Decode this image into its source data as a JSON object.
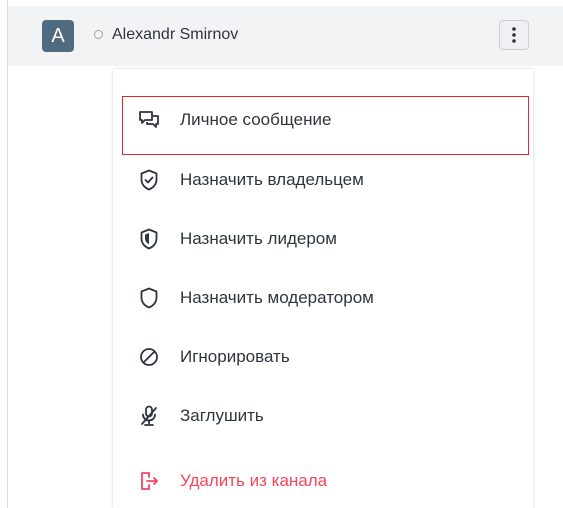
{
  "user": {
    "avatar_letter": "A",
    "name": "Alexandr Smirnov",
    "status": "offline"
  },
  "header": {
    "kebab_icon": "kebab-menu-icon"
  },
  "menu": {
    "items": [
      {
        "label": "Личное сообщение",
        "icon": "direct-message-icon",
        "danger": false
      },
      {
        "label": "Назначить владельцем",
        "icon": "shield-check-icon",
        "danger": false
      },
      {
        "label": "Назначить лидером",
        "icon": "shield-blank-icon",
        "danger": false
      },
      {
        "label": "Назначить модератором",
        "icon": "shield-icon",
        "danger": false
      },
      {
        "label": "Игнорировать",
        "icon": "ban-icon",
        "danger": false
      },
      {
        "label": "Заглушить",
        "icon": "mic-off-icon",
        "danger": false
      },
      {
        "label": "Удалить из канала",
        "icon": "sign-out-icon",
        "danger": true
      }
    ]
  },
  "colors": {
    "avatar_bg": "#4f6b7f",
    "danger": "#f5455c",
    "highlight": "#e0262f",
    "text": "#2f343d"
  }
}
